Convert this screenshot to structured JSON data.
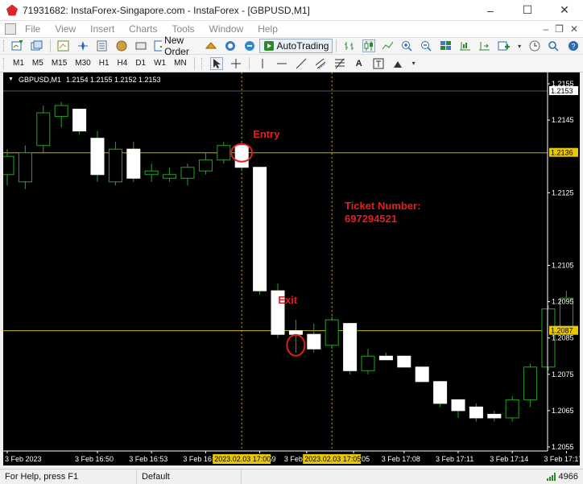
{
  "window": {
    "title": "71931682: InstaForex-Singapore.com - InstaForex - [GBPUSD,M1]",
    "minimize": "–",
    "maximize": "☐",
    "close": "✕"
  },
  "menu": {
    "items": [
      "File",
      "View",
      "Insert",
      "Charts",
      "Tools",
      "Window",
      "Help"
    ],
    "right_minimize": "–",
    "right_restore": "❐",
    "right_close": "✕"
  },
  "toolbar1": {
    "new_order": "New Order",
    "autotrading": "AutoTrading"
  },
  "toolbar2": {
    "timeframes": [
      "M1",
      "M5",
      "M15",
      "M30",
      "H1",
      "H4",
      "D1",
      "W1",
      "MN"
    ],
    "text_tool": "A"
  },
  "chart": {
    "header_symbol": "GBPUSD,M1",
    "header_ohlc": "1.2154 1.2155 1.2152 1.2153",
    "annotations": {
      "entry": "Entry",
      "exit": "Exit",
      "ticket_label": "Ticket Number:",
      "ticket_value": "697294521"
    },
    "colors": {
      "background": "#000000",
      "candle_border": "#2aa02a",
      "bull_fill": "#000000",
      "bear_fill": "#ffffff",
      "hline": "#c8b400",
      "annotation": "#e02020"
    }
  },
  "chart_data": {
    "type": "candlestick",
    "symbol": "GBPUSD",
    "timeframe": "M1",
    "ylim": [
      1.2055,
      1.2157
    ],
    "y_ticks": [
      "1.2155",
      "1.2145",
      "1.2125",
      "1.2105",
      "1.2095",
      "1.2085",
      "1.2075",
      "1.2065",
      "1.2055"
    ],
    "price_labels": [
      {
        "value": "1.2153",
        "style": "current"
      },
      {
        "value": "1.2136",
        "style": "hline"
      },
      {
        "value": "1.2087",
        "style": "hline"
      }
    ],
    "hlines": [
      1.2136,
      1.2087
    ],
    "x_ticks": [
      "3 Feb 2023",
      "3 Feb 16:50",
      "3 Feb 16:53",
      "3 Feb 16:56",
      "3 Feb 16:59",
      "3 Feb 1",
      "3 Feb 17:05",
      "3 Feb 17:08",
      "3 Feb 17:11",
      "3 Feb 17:14",
      "3 Feb 17:17"
    ],
    "vlines_labels": [
      "2023.02.03 17:00",
      "2023.02.03 17:05"
    ],
    "vline_candles": [
      13,
      18
    ],
    "candles": [
      {
        "o": 1.213,
        "h": 1.2137,
        "l": 1.2127,
        "c": 1.2135
      },
      {
        "o": 1.2128,
        "h": 1.2138,
        "l": 1.2126,
        "c": 1.2136
      },
      {
        "o": 1.2138,
        "h": 1.2149,
        "l": 1.2136,
        "c": 1.2147
      },
      {
        "o": 1.2146,
        "h": 1.215,
        "l": 1.2143,
        "c": 1.2149
      },
      {
        "o": 1.2148,
        "h": 1.2148,
        "l": 1.2141,
        "c": 1.2142
      },
      {
        "o": 1.214,
        "h": 1.2142,
        "l": 1.2128,
        "c": 1.213
      },
      {
        "o": 1.2128,
        "h": 1.2139,
        "l": 1.2127,
        "c": 1.2137
      },
      {
        "o": 1.2137,
        "h": 1.2139,
        "l": 1.2128,
        "c": 1.2129
      },
      {
        "o": 1.213,
        "h": 1.2133,
        "l": 1.2128,
        "c": 1.2131
      },
      {
        "o": 1.2129,
        "h": 1.2132,
        "l": 1.2128,
        "c": 1.213
      },
      {
        "o": 1.2129,
        "h": 1.2133,
        "l": 1.2127,
        "c": 1.2132
      },
      {
        "o": 1.2131,
        "h": 1.2136,
        "l": 1.213,
        "c": 1.2134
      },
      {
        "o": 1.2134,
        "h": 1.2139,
        "l": 1.2133,
        "c": 1.2138
      },
      {
        "o": 1.2138,
        "h": 1.2139,
        "l": 1.2131,
        "c": 1.2132
      },
      {
        "o": 1.2132,
        "h": 1.2132,
        "l": 1.2097,
        "c": 1.2098
      },
      {
        "o": 1.2098,
        "h": 1.21,
        "l": 1.2085,
        "c": 1.2086
      },
      {
        "o": 1.2087,
        "h": 1.209,
        "l": 1.2081,
        "c": 1.2086
      },
      {
        "o": 1.2086,
        "h": 1.2089,
        "l": 1.2081,
        "c": 1.2082
      },
      {
        "o": 1.2083,
        "h": 1.2091,
        "l": 1.2082,
        "c": 1.209
      },
      {
        "o": 1.2089,
        "h": 1.2089,
        "l": 1.2075,
        "c": 1.2076
      },
      {
        "o": 1.2076,
        "h": 1.2082,
        "l": 1.2075,
        "c": 1.208
      },
      {
        "o": 1.208,
        "h": 1.2081,
        "l": 1.2079,
        "c": 1.2079
      },
      {
        "o": 1.208,
        "h": 1.208,
        "l": 1.2077,
        "c": 1.2077
      },
      {
        "o": 1.2077,
        "h": 1.2077,
        "l": 1.2073,
        "c": 1.2073
      },
      {
        "o": 1.2073,
        "h": 1.2073,
        "l": 1.2066,
        "c": 1.2067
      },
      {
        "o": 1.2068,
        "h": 1.2068,
        "l": 1.2063,
        "c": 1.2065
      },
      {
        "o": 1.2066,
        "h": 1.2067,
        "l": 1.2062,
        "c": 1.2063
      },
      {
        "o": 1.2064,
        "h": 1.2065,
        "l": 1.2062,
        "c": 1.2063
      },
      {
        "o": 1.2063,
        "h": 1.2069,
        "l": 1.2062,
        "c": 1.2068
      },
      {
        "o": 1.2068,
        "h": 1.2078,
        "l": 1.2066,
        "c": 1.2077
      },
      {
        "o": 1.2077,
        "h": 1.2094,
        "l": 1.2076,
        "c": 1.2093
      },
      {
        "o": 1.2087,
        "h": 1.2098,
        "l": 1.2086,
        "c": 1.2096
      }
    ]
  },
  "status": {
    "help": "For Help, press F1",
    "profile": "Default",
    "traffic": "4966"
  }
}
